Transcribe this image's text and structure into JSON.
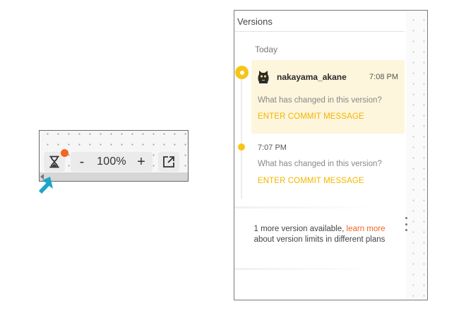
{
  "toolbar": {
    "zoom_minus": "-",
    "zoom_value": "100%",
    "zoom_plus": "+",
    "history_icon": "hourglass-icon",
    "export_icon": "external-link-icon",
    "notification_color": "#f26522",
    "pointer_color": "#1aa6c8"
  },
  "versions_panel": {
    "title": "Versions",
    "section_label": "Today",
    "accent_color": "#f5c518",
    "current_version": {
      "author": "nakayama_akane",
      "time": "7:08 PM",
      "prompt": "What has changed in this version?",
      "commit_label": "ENTER COMMIT MESSAGE",
      "avatar_icon": "cat-avatar-icon"
    },
    "older_version": {
      "time": "7:07 PM",
      "prompt": "What has changed in this version?",
      "commit_label": "ENTER COMMIT MESSAGE"
    },
    "footer": {
      "prefix": "1 more version available, ",
      "link": "learn more",
      "suffix": "about version limits in different plans"
    }
  }
}
